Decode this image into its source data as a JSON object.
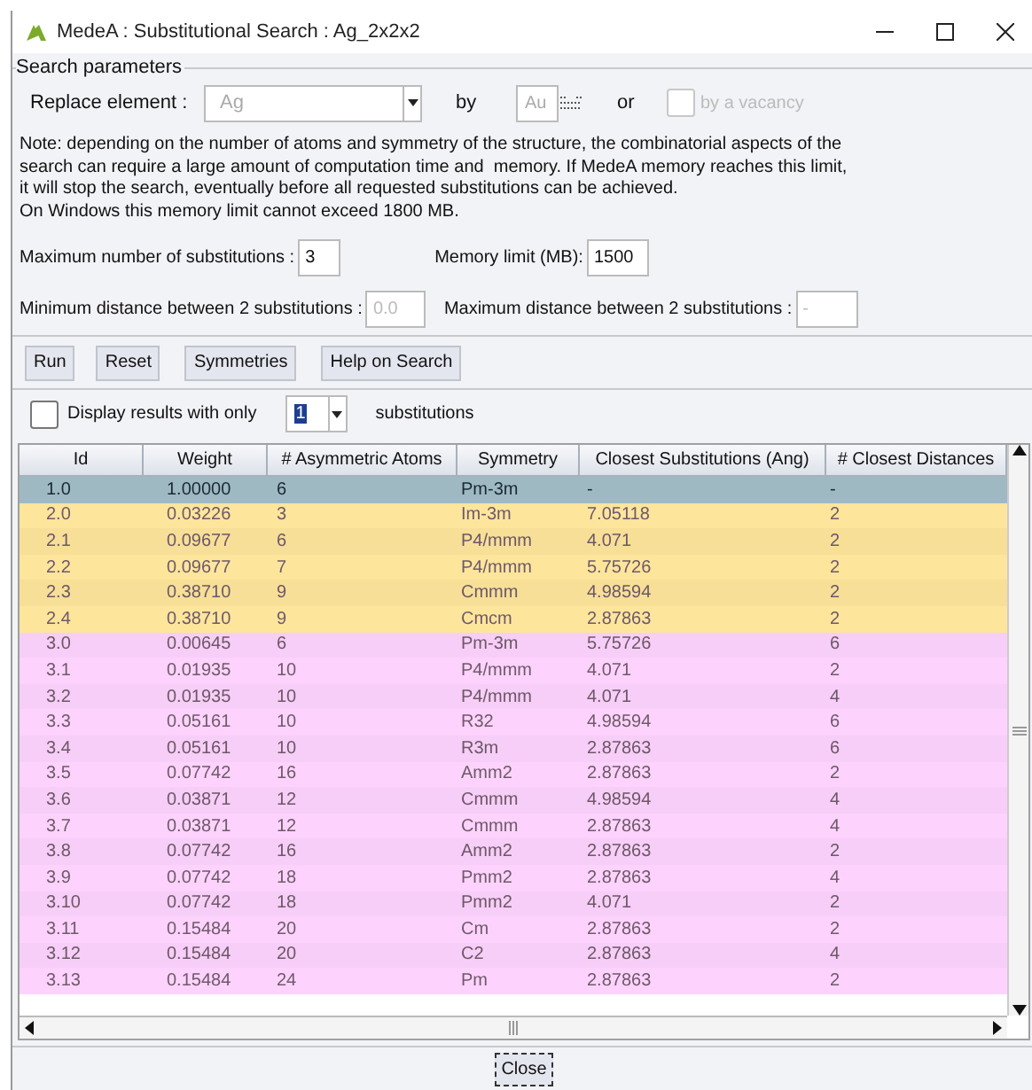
{
  "window": {
    "title": "MedeA : Substitutional Search : Ag_2x2x2"
  },
  "search_parameters": {
    "legend": "Search parameters",
    "replace_label": "Replace element :",
    "replace_value": "Ag",
    "by_label": "by",
    "by_value": "Au",
    "or_label": "or",
    "vacancy": {
      "label": "by a vacancy",
      "checked": false,
      "disabled": true
    },
    "note": [
      "Note: depending on the number of atoms and symmetry of the structure, the combinatorial aspects of the",
      "search can require a large amount of computation time and  memory. If MedeA memory reaches this limit,",
      "it will stop the search, eventually before all requested substitutions can be achieved.",
      "On Windows this memory limit cannot exceed 1800 MB."
    ],
    "max_subs_label": "Maximum number of substitutions :",
    "max_subs_value": "3",
    "memory_label": "Memory limit (MB):",
    "memory_value": "1500",
    "min_dist_label": "Minimum distance between 2 substitutions :",
    "min_dist_placeholder": "0.0",
    "max_dist_label": "Maximum distance between 2 substitutions :",
    "max_dist_placeholder": "-"
  },
  "buttons": [
    "Run",
    "Reset",
    "Symmetries",
    "Help on Search"
  ],
  "filter": {
    "label": "Display results with only",
    "checked": false,
    "value": "1",
    "suffix": "substitutions"
  },
  "table": {
    "columns": [
      "Id",
      "Weight",
      "# Asymmetric Atoms",
      "Symmetry",
      "Closest Substitutions (Ang)",
      "# Closest Distances"
    ],
    "rows": [
      {
        "cells": [
          "1.0",
          "1.00000",
          "6",
          "Pm-3m",
          "-",
          "-"
        ],
        "color": "#9fb9c3",
        "selected": true
      },
      {
        "cells": [
          "2.0",
          "0.03226",
          "3",
          "Im-3m",
          "7.05118",
          "2"
        ],
        "color": "#fde59c",
        "selected": false
      },
      {
        "cells": [
          "2.1",
          "0.09677",
          "6",
          "P4/mmm",
          "4.071",
          "2"
        ],
        "color": "#fde59c",
        "selected": false
      },
      {
        "cells": [
          "2.2",
          "0.09677",
          "7",
          "P4/mmm",
          "5.75726",
          "2"
        ],
        "color": "#fde59c",
        "selected": false
      },
      {
        "cells": [
          "2.3",
          "0.38710",
          "9",
          "Cmmm",
          "4.98594",
          "2"
        ],
        "color": "#fde59c",
        "selected": false
      },
      {
        "cells": [
          "2.4",
          "0.38710",
          "9",
          "Cmcm",
          "2.87863",
          "2"
        ],
        "color": "#fde59c",
        "selected": false
      },
      {
        "cells": [
          "3.0",
          "0.00645",
          "6",
          "Pm-3m",
          "5.75726",
          "6"
        ],
        "color": "#fdd3fd",
        "selected": false
      },
      {
        "cells": [
          "3.1",
          "0.01935",
          "10",
          "P4/mmm",
          "4.071",
          "2"
        ],
        "color": "#fdd3fd",
        "selected": false
      },
      {
        "cells": [
          "3.2",
          "0.01935",
          "10",
          "P4/mmm",
          "4.071",
          "4"
        ],
        "color": "#fdd3fd",
        "selected": false
      },
      {
        "cells": [
          "3.3",
          "0.05161",
          "10",
          "R32",
          "4.98594",
          "6"
        ],
        "color": "#fdd3fd",
        "selected": false
      },
      {
        "cells": [
          "3.4",
          "0.05161",
          "10",
          "R3m",
          "2.87863",
          "6"
        ],
        "color": "#fdd3fd",
        "selected": false
      },
      {
        "cells": [
          "3.5",
          "0.07742",
          "16",
          "Amm2",
          "2.87863",
          "2"
        ],
        "color": "#fdd3fd",
        "selected": false
      },
      {
        "cells": [
          "3.6",
          "0.03871",
          "12",
          "Cmmm",
          "4.98594",
          "4"
        ],
        "color": "#fdd3fd",
        "selected": false
      },
      {
        "cells": [
          "3.7",
          "0.03871",
          "12",
          "Cmmm",
          "2.87863",
          "4"
        ],
        "color": "#fdd3fd",
        "selected": false
      },
      {
        "cells": [
          "3.8",
          "0.07742",
          "16",
          "Amm2",
          "2.87863",
          "2"
        ],
        "color": "#fdd3fd",
        "selected": false
      },
      {
        "cells": [
          "3.9",
          "0.07742",
          "18",
          "Pmm2",
          "2.87863",
          "4"
        ],
        "color": "#fdd3fd",
        "selected": false
      },
      {
        "cells": [
          "3.10",
          "0.07742",
          "18",
          "Pmm2",
          "4.071",
          "2"
        ],
        "color": "#fdd3fd",
        "selected": false
      },
      {
        "cells": [
          "3.11",
          "0.15484",
          "20",
          "Cm",
          "2.87863",
          "2"
        ],
        "color": "#fdd3fd",
        "selected": false
      },
      {
        "cells": [
          "3.12",
          "0.15484",
          "20",
          "C2",
          "2.87863",
          "4"
        ],
        "color": "#fdd3fd",
        "selected": false
      },
      {
        "cells": [
          "3.13",
          "0.15484",
          "24",
          "Pm",
          "2.87863",
          "2"
        ],
        "color": "#fdd3fd",
        "selected": false
      }
    ]
  },
  "close_button": "Close"
}
